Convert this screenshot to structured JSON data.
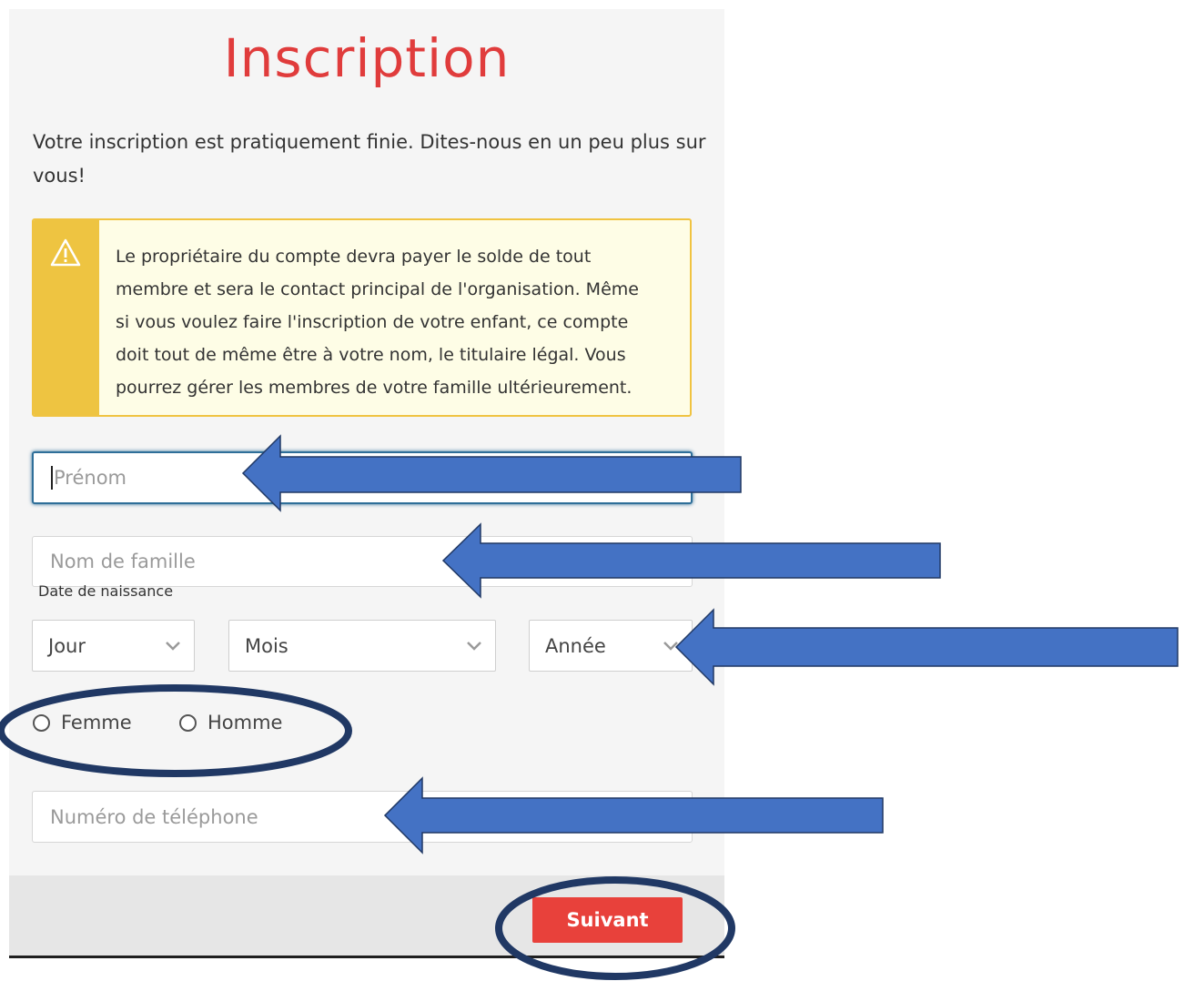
{
  "page": {
    "title": "Inscription",
    "intro": "Votre inscription est pratiquement finie. Dites-nous en un peu plus sur vous!"
  },
  "alert": {
    "icon": "warning-icon",
    "lines": [
      "Le propriétaire du compte devra payer le solde de tout",
      "membre et sera le contact principal de l'organisation. Même",
      "si vous voulez faire l'inscription de votre enfant, ce compte",
      "doit tout de même être à votre nom, le titulaire légal. Vous",
      "pourrez gérer les membres de votre famille ultérieurement."
    ]
  },
  "form": {
    "first_name_placeholder": "Prénom",
    "last_name_placeholder": "Nom de famille",
    "birthdate_label": "Date de naissance",
    "day_value": "Jour",
    "month_value": "Mois",
    "year_value": "Année",
    "gender_female": "Femme",
    "gender_male": "Homme",
    "phone_placeholder": "Numéro de téléphone"
  },
  "footer": {
    "next_label": "Suivant"
  },
  "colors": {
    "title": "#e03c3c",
    "alert_side": "#eec441",
    "alert_bg": "#fefde6",
    "button": "#e8413b",
    "annotation": "#4472c4",
    "annotation_outline": "#203864"
  }
}
